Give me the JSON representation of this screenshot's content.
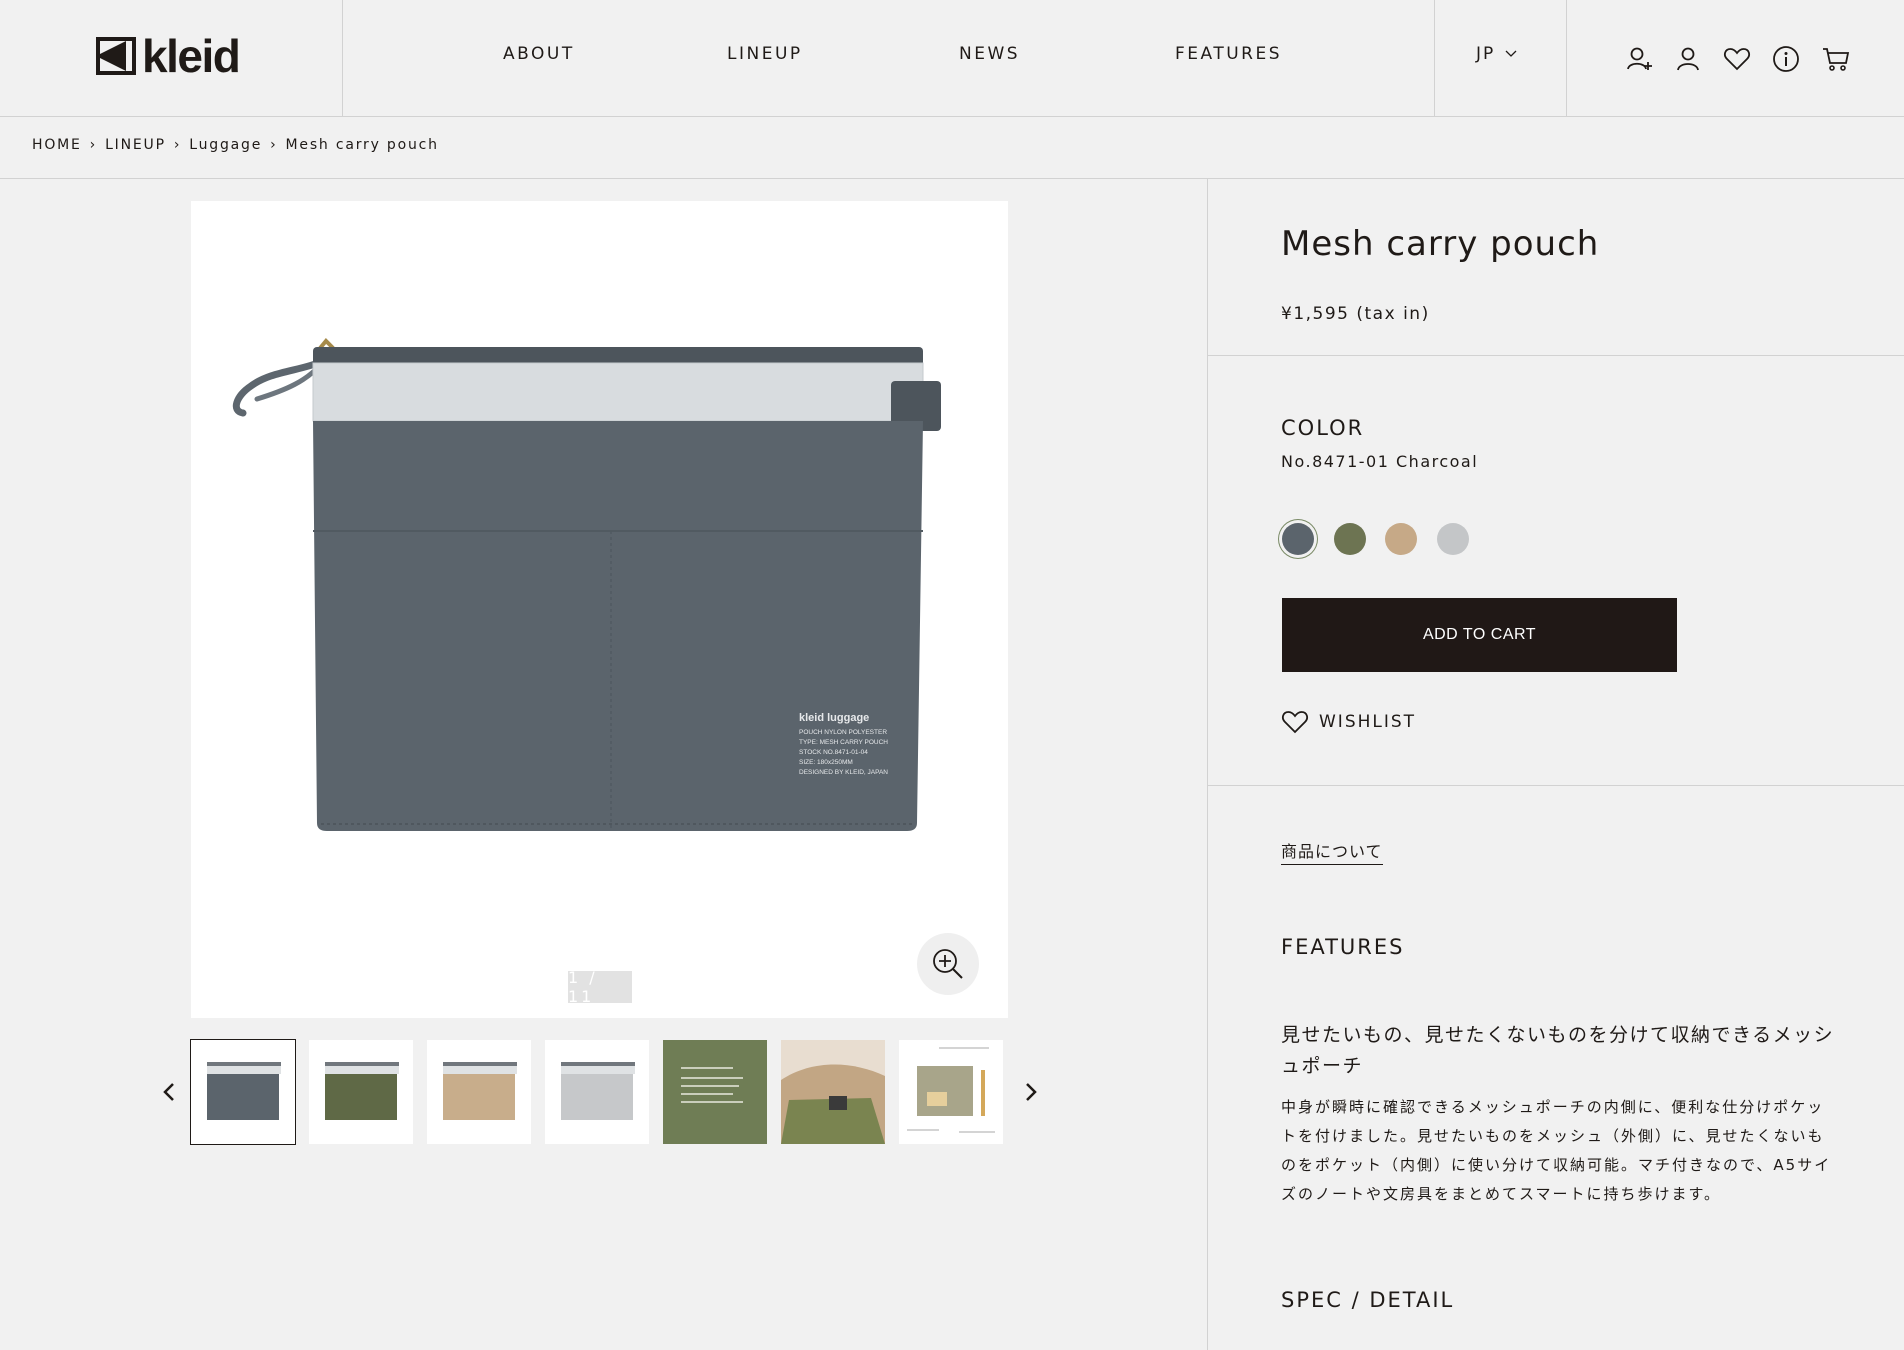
{
  "header": {
    "brand": "kleid",
    "nav": [
      "ABOUT",
      "LINEUP",
      "NEWS",
      "FEATURES"
    ],
    "lang": "JP",
    "icons": [
      "user-add-icon",
      "user-icon",
      "heart-icon",
      "info-icon",
      "cart-icon"
    ]
  },
  "breadcrumb": {
    "items": [
      "HOME",
      "LINEUP",
      "Luggage",
      "Mesh carry pouch"
    ],
    "separator": "›"
  },
  "gallery": {
    "counter": "1 / 11",
    "thumbnails": [
      {
        "name": "Charcoal",
        "color": "#5b646c"
      },
      {
        "name": "Olive",
        "color": "#5f6946"
      },
      {
        "name": "Beige",
        "color": "#c8ad8b"
      },
      {
        "name": "Light gray",
        "color": "#c6c8ca"
      },
      {
        "name": "Label detail",
        "color": "#6f7d55"
      },
      {
        "name": "Lifestyle",
        "color": "#c2a684"
      },
      {
        "name": "Diagram",
        "color": "#d9d6ce"
      }
    ],
    "product_label": [
      "kleid luggage",
      "POUCH NYLON POLYESTER",
      "TYPE: MESH CARRY POUCH",
      "STOCK NO.8471-01-04",
      "SIZE: 180x250MM",
      "DESIGNED BY KLEID, JAPAN"
    ]
  },
  "product": {
    "title": "Mesh carry pouch",
    "price": "¥1,595 (tax in)",
    "color_heading": "COLOR",
    "color_value": "No.8471-01 Charcoal",
    "swatches": [
      "#5b646c",
      "#6d7452",
      "#c6a987",
      "#c4c6c8"
    ],
    "add_to_cart": "ADD TO CART",
    "wishlist": "WISHLIST",
    "about_link": "商品について",
    "features_heading": "FEATURES",
    "features_lead": "見せたいもの、見せたくないものを分けて収納できるメッシュポーチ",
    "features_body": "中身が瞬時に確認できるメッシュポーチの内側に、便利な仕分けポケットを付けました。見せたいものをメッシュ（外側）に、見せたくないものをポケット（内側）に使い分けて収納可能。マチ付きなので、A5サイズのノートや文房具をまとめてスマートに持ち歩けます。",
    "spec_heading": "SPEC / DETAIL"
  }
}
